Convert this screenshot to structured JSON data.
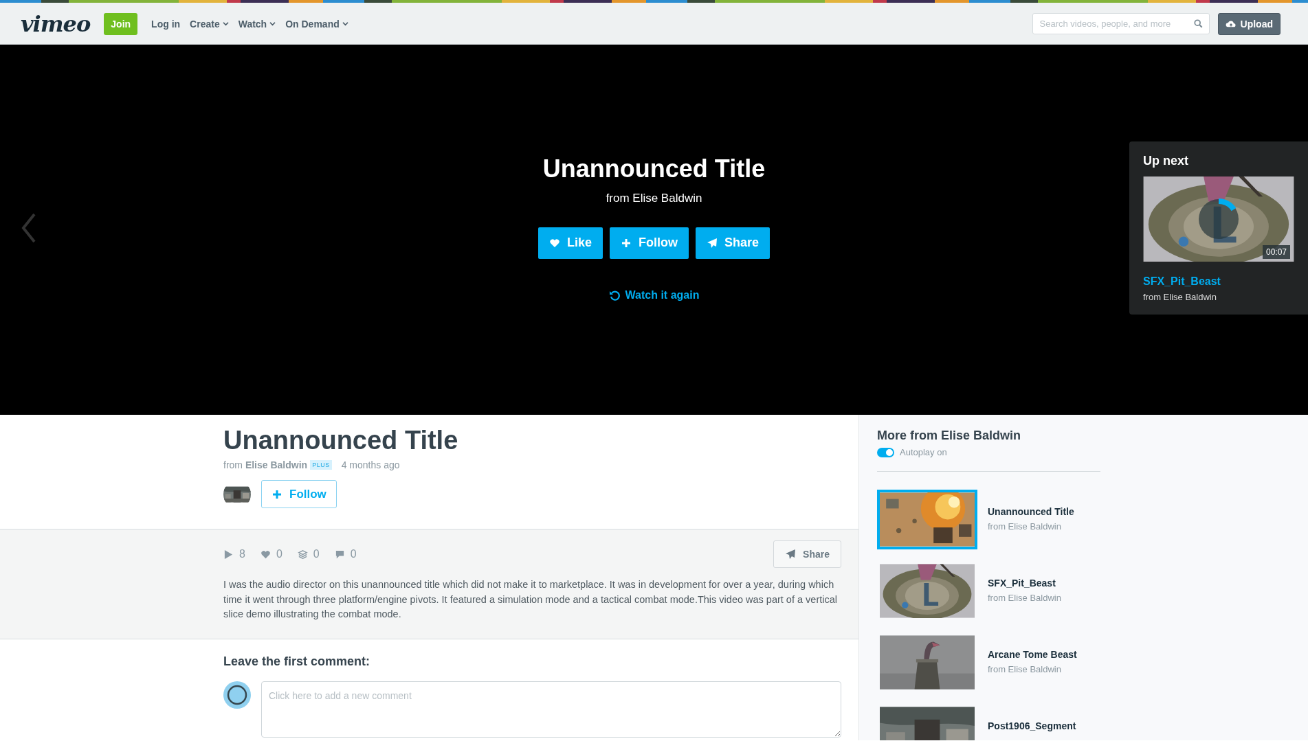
{
  "nav": {
    "logo": "vimeo",
    "join": "Join",
    "links": [
      {
        "label": "Log in",
        "menu": false
      },
      {
        "label": "Create",
        "menu": true
      },
      {
        "label": "Watch",
        "menu": true
      },
      {
        "label": "On Demand",
        "menu": true
      }
    ],
    "search": {
      "placeholder": "Search videos, people, and more"
    },
    "upload": "Upload"
  },
  "player": {
    "title": "Unannounced Title",
    "byline": "from Elise Baldwin",
    "buttons": [
      {
        "kind": "like",
        "label": "Like"
      },
      {
        "kind": "follow",
        "label": "Follow"
      },
      {
        "kind": "share",
        "label": "Share"
      }
    ],
    "watch_again": "Watch it again",
    "up_next": {
      "heading": "Up next",
      "duration": "00:07",
      "title": "SFX_Pit_Beast",
      "byline": "from Elise Baldwin"
    }
  },
  "video": {
    "title": "Unannounced Title",
    "byline": "from **Elise Baldwin**",
    "badge": "PLUS",
    "age": "4 months ago",
    "follow": "Follow",
    "stats": [
      {
        "kind": "plays",
        "value": "8"
      },
      {
        "kind": "likes",
        "value": "0"
      },
      {
        "kind": "collections",
        "value": "0"
      },
      {
        "kind": "comments",
        "value": "0"
      }
    ],
    "share": "Share",
    "description": "I was the audio director on this unannounced title which did not make it to marketplace. It was in development for over a year, during which time it went through three platform/engine pivots. It featured a simulation mode and a tactical combat mode.This video was part of a vertical slice demo illustrating the combat mode."
  },
  "comments": {
    "heading": "Leave the first comment:",
    "placeholder": "Click here to add a new comment"
  },
  "sidebar": {
    "heading": "More from **Elise Baldwin**",
    "autoplay": {
      "label": "Autoplay on",
      "on": true
    },
    "videos": [
      {
        "title": "Unannounced Title",
        "byline": "from Elise Baldwin",
        "selected": true
      },
      {
        "title": "SFX_Pit_Beast",
        "byline": "from Elise Baldwin",
        "selected": false
      },
      {
        "title": "Arcane Tome Beast",
        "byline": "from Elise Baldwin",
        "selected": false
      },
      {
        "title": "Post1906_Segment",
        "selected": false
      }
    ]
  }
}
